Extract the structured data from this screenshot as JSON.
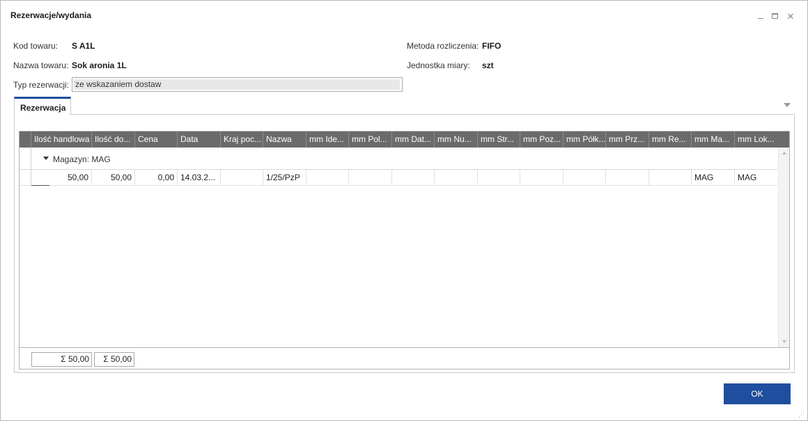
{
  "window": {
    "title": "Rezerwacje/wydania"
  },
  "fields": {
    "kod_towaru": {
      "label": "Kod towaru:",
      "value": "S A1L"
    },
    "nazwa_towaru": {
      "label": "Nazwa towaru:",
      "value": "Sok aronia 1L"
    },
    "typ_rezerwacji": {
      "label": "Typ rezerwacji:",
      "value": "ze wskazaniem dostaw"
    },
    "metoda_rozliczenia": {
      "label": "Metoda rozliczenia:",
      "value": "FIFO"
    },
    "jednostka_miary": {
      "label": "Jednostka miary:",
      "value": "szt"
    }
  },
  "tabs": [
    {
      "label": "Rezerwacja"
    }
  ],
  "grid": {
    "columns": [
      "Ilość handlowa",
      "Ilość do...",
      "Cena",
      "Data",
      "Kraj poc...",
      "Nazwa",
      "mm Ide...",
      "mm Pol...",
      "mm Dat...",
      "mm Nu...",
      "mm Str...",
      "mm Poz...",
      "mm Półk...",
      "mm Prz...",
      "mm Re...",
      "mm Ma...",
      "mm Lok..."
    ],
    "group": {
      "label": "Magazyn: MAG"
    },
    "rows": [
      [
        "50,00",
        "50,00",
        "0,00",
        "14.03.2...",
        "",
        "1/25/PzP",
        "",
        "",
        "",
        "",
        "",
        "",
        "",
        "",
        "",
        "MAG",
        "MAG"
      ]
    ],
    "sums": [
      "Σ  50,00",
      "Σ  50,00"
    ]
  },
  "buttons": {
    "ok": "OK"
  },
  "colors": {
    "accent": "#1f4e9e",
    "header": "#6b6b6b"
  }
}
